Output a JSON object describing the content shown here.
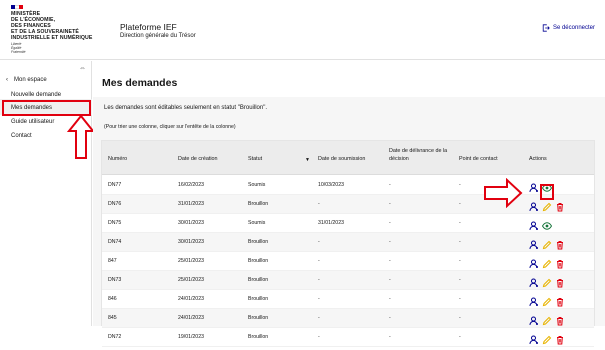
{
  "header": {
    "ministry_lines": [
      "MINISTÈRE",
      "DE L'ÉCONOMIE,",
      "DES FINANCES",
      "ET DE LA SOUVERAINETÉ",
      "INDUSTRIELLE ET NUMÉRIQUE"
    ],
    "motto": [
      "Liberté",
      "Égalité",
      "Fraternité"
    ],
    "site_title": "Plateforme IEF",
    "site_subtitle": "Direction générale du Trésor",
    "logout_label": "Se déconnecter",
    "flag_colors": [
      "#000091",
      "#ffffff",
      "#e1000f"
    ]
  },
  "sidebar": {
    "back_label": "Mon espace",
    "items": [
      "Nouvelle demande",
      "Mes demandes",
      "Guide utilisateur",
      "Contact"
    ]
  },
  "main": {
    "title": "Mes demandes",
    "info": "Les demandes sont éditables seulement en statut \"Brouillon\".",
    "hint": "(Pour trier une colonne, cliquer sur l'entête de la colonne)",
    "columns": [
      "Numéro",
      "Date de création",
      "Statut",
      "Date de soumission",
      "Date de délivrance de la décision",
      "Point de contact",
      "Actions"
    ],
    "rows": [
      [
        "DN77",
        "16/02/2023",
        "Soumis",
        "10/03/2023",
        "-",
        "-"
      ],
      [
        "DN76",
        "31/01/2023",
        "Brouillon",
        "-",
        "-",
        "-"
      ],
      [
        "DN75",
        "30/01/2023",
        "Soumis",
        "31/01/2023",
        "-",
        "-"
      ],
      [
        "DN74",
        "30/01/2023",
        "Brouillon",
        "-",
        "-",
        "-"
      ],
      [
        "847",
        "25/01/2023",
        "Brouillon",
        "-",
        "-",
        "-"
      ],
      [
        "DN73",
        "25/01/2023",
        "Brouillon",
        "-",
        "-",
        "-"
      ],
      [
        "846",
        "24/01/2023",
        "Brouillon",
        "-",
        "-",
        "-"
      ],
      [
        "845",
        "24/01/2023",
        "Brouillon",
        "-",
        "-",
        "-"
      ],
      [
        "DN72",
        "19/01/2023",
        "Brouillon",
        "-",
        "-",
        "-"
      ]
    ],
    "row_actions": [
      [
        "user-icon",
        "view-icon"
      ],
      [
        "user-icon",
        "edit-icon",
        "delete-icon"
      ],
      [
        "user-icon",
        "view-icon"
      ],
      [
        "user-icon",
        "edit-icon",
        "delete-icon"
      ],
      [
        "user-icon",
        "edit-icon",
        "delete-icon"
      ],
      [
        "user-icon",
        "edit-icon",
        "delete-icon"
      ],
      [
        "user-icon",
        "edit-icon",
        "delete-icon"
      ],
      [
        "user-icon",
        "edit-icon",
        "delete-icon"
      ],
      [
        "user-icon",
        "edit-icon",
        "delete-icon"
      ]
    ]
  },
  "colors": {
    "primary": "#000091",
    "annotation_red": "#e1000f",
    "edit_yellow": "#e8b400",
    "view_green": "#18753c"
  }
}
